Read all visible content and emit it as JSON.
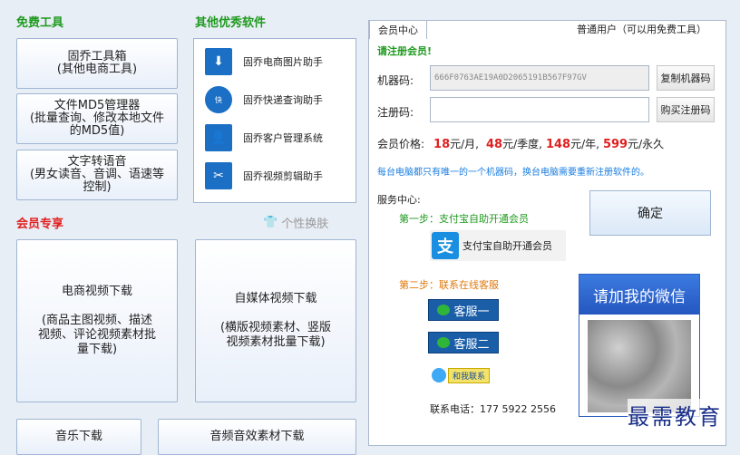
{
  "free_tools": {
    "title": "免费工具",
    "buttons": [
      "固乔工具箱\n(其他电商工具)",
      "文件MD5管理器\n(批量查询、修改本地文件\n的MD5值)",
      "文字转语音\n(男女读音、音调、语速等\n控制)"
    ]
  },
  "other_software": {
    "title": "其他优秀软件",
    "items": [
      "固乔电商图片助手",
      "固乔快递查询助手",
      "固乔客户管理系统",
      "固乔视频剪辑助手"
    ],
    "icons": [
      "download-icon",
      "express-icon",
      "customer-icon",
      "scissors-icon"
    ]
  },
  "skin": {
    "label": "个性换肤"
  },
  "member_exclusive": {
    "title": "会员专享",
    "buttons": [
      "电商视频下载\n\n(商品主图视频、描述\n视频、评论视频素材批\n量下载)",
      "自媒体视频下载\n\n(横版视频素材、竖版\n视频素材批量下载)"
    ],
    "bottom_buttons": [
      "音乐下载",
      "音频音效素材下载"
    ]
  },
  "member_center": {
    "tab": "会员中心",
    "user_type": "普通用户（可以用免费工具）",
    "register_prompt": "请注册会员!",
    "machine_code_label": "机器码:",
    "machine_code_value": "666F0763AE19A0D2065191B567F97GV",
    "copy_button": "复制机器码",
    "reg_code_label": "注册码:",
    "reg_code_value": "",
    "buy_button": "购买注册码",
    "price_label": "会员价格:",
    "prices": [
      {
        "amount": "18",
        "unit": "元/月,"
      },
      {
        "amount": "48",
        "unit": "元/季度,"
      },
      {
        "amount": "148",
        "unit": "元/年,"
      },
      {
        "amount": "599",
        "unit": "元/永久"
      }
    ],
    "notice": "每台电脑都只有唯一的一个机器码，换台电脑需要重新注册软件的。",
    "service_label": "服务中心:",
    "step1": "第一步：支付宝自助开通会员",
    "alipay_button": "支付宝自助开通会员",
    "confirm_button": "确定",
    "step2": "第二步：联系在线客服",
    "service_buttons": [
      "客服一",
      "客服二"
    ],
    "qq_label": "和我联系",
    "phone_label": "联系电话：",
    "phone": "177 5922 2556",
    "wechat_banner": "请加我的微信"
  },
  "watermark": "最需教育"
}
